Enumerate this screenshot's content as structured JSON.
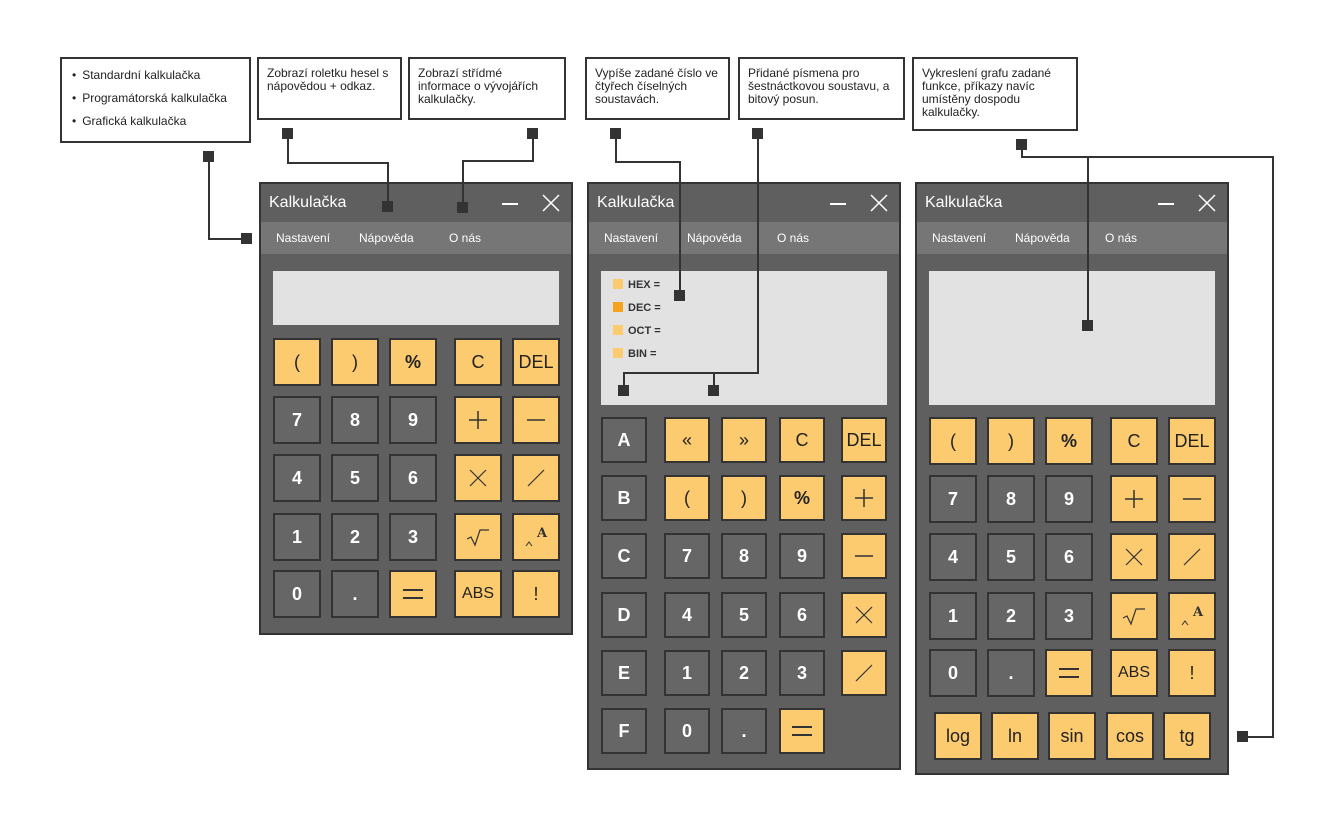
{
  "notes": {
    "types": [
      "Standardní kalkulačka",
      "Programátorská kalkulačka",
      "Grafická kalkulačka"
    ],
    "help": "Zobrazí roletku hesel s nápovědou + odkaz.",
    "about": "Zobrazí střídmé informace o vývojářích kalkulačky.",
    "bases": "Vypíše zadané číslo ve čtyřech číselných soustavách.",
    "hex_letters": "Přidané písmena pro šestnáctkovou soustavu, a bitový posun.",
    "graph": "Vykreslení grafu zadané funkce, příkazy navíc umístěny dospodu kalkulačky."
  },
  "window": {
    "title": "Kalkulačka",
    "menu": [
      "Nastavení",
      "Nápověda",
      "O nás"
    ]
  },
  "programmer": {
    "bases": [
      "HEX =",
      "DEC =",
      "OCT =",
      "BIN ="
    ],
    "active_base": "DEC ="
  },
  "standard_keys": [
    "(",
    ")",
    "%",
    "C",
    "DEL",
    "7",
    "8",
    "9",
    "4",
    "5",
    "6",
    "1",
    "2",
    "3",
    "0",
    ".",
    "ABS",
    "!"
  ],
  "programmer_keys": [
    "A",
    "«",
    "»",
    "C",
    "DEL",
    "B",
    "(",
    ")",
    "%",
    "C",
    "7",
    "8",
    "9",
    "D",
    "4",
    "5",
    "6",
    "E",
    "1",
    "2",
    "3",
    "F",
    "0",
    "."
  ],
  "graphing_extra_keys": [
    "log",
    "ln",
    "sin",
    "cos",
    "tg"
  ],
  "colors": {
    "key_orange": "#fcca6f",
    "key_gray": "#666666",
    "window": "#5f5f5f",
    "menubar": "#767676",
    "display": "#e2e2e2",
    "base_marker": "#fcca6f",
    "base_marker_active": "#f6a21d"
  },
  "icons": [
    "minimize-icon",
    "close-icon",
    "plus-icon",
    "minus-icon",
    "multiply-icon",
    "divide-icon",
    "sqrt-icon",
    "power-icon",
    "equals-icon"
  ]
}
